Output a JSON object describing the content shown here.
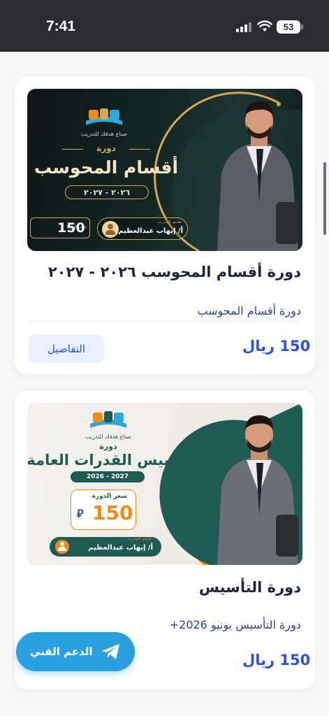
{
  "status_bar": {
    "time": "7:41",
    "battery": "53"
  },
  "courses": [
    {
      "banner": {
        "logo_text": "صناع هدفك للتدريب",
        "label": "دورة",
        "title": "أقسام المحوسب",
        "years": "٢٠٢٦ - ٢٠٢٧",
        "price_label": "سعر الدورة",
        "price": "150",
        "trainer_label": "تقديم المدرب",
        "trainer_name": "أ/ إيهاب عبدالعظيم"
      },
      "title": "دورة أقسام المحوسب ٢٠٢٦ - ٢٠٢٧",
      "subtitle": "دورة أقسام المحوسب",
      "price": "150 ريال",
      "details_label": "التفاصيل"
    },
    {
      "banner": {
        "logo_text": "صناع هدفك للتدريب",
        "label": "دورة",
        "title": "تأسيس القدرات العامة",
        "years": "2026 - 2027",
        "price_label": "سعر الدورة",
        "price": "150",
        "trainer_label": "تقديم المدرب",
        "trainer_name": "أ/ إيهاب عبدالعظيم"
      },
      "title": "دورة التأسيس",
      "subtitle": "دورة التأسيس يونيو 2026+",
      "price": "150 ريال"
    }
  ],
  "support_button": {
    "label": "الدعم الفني"
  },
  "colors": {
    "accent": "#2a52e0",
    "support": "#2b9fe0",
    "banner_dark": "#132624",
    "gold": "#d4a856",
    "teal": "#1f5a55",
    "orange": "#f08a1c"
  }
}
